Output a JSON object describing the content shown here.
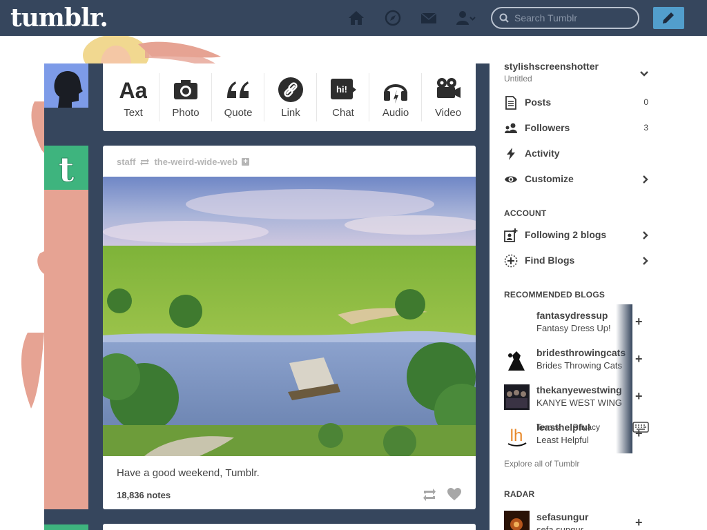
{
  "header": {
    "logo": "tumblr.",
    "search_placeholder": "Search Tumblr",
    "nav_icons": [
      "home-icon",
      "explore-icon",
      "inbox-icon",
      "account-icon",
      "compose-icon"
    ]
  },
  "post_types": [
    {
      "label": "Text",
      "icon": "text-icon"
    },
    {
      "label": "Photo",
      "icon": "camera-icon"
    },
    {
      "label": "Quote",
      "icon": "quote-icon"
    },
    {
      "label": "Link",
      "icon": "link-icon"
    },
    {
      "label": "Chat",
      "icon": "chat-icon",
      "bubble": "hi!"
    },
    {
      "label": "Audio",
      "icon": "headphones-icon"
    },
    {
      "label": "Video",
      "icon": "video-camera-icon"
    }
  ],
  "post": {
    "author": "staff",
    "reblogged_from": "the-weird-wide-web",
    "caption": "Have a good weekend, Tumblr.",
    "notes": "18,836 notes"
  },
  "sidebar": {
    "blog_name": "stylishscreenshotter",
    "blog_title": "Untitled",
    "items": [
      {
        "label": "Posts",
        "count": "0",
        "icon": "posts-icon"
      },
      {
        "label": "Followers",
        "count": "3",
        "icon": "followers-icon"
      },
      {
        "label": "Activity",
        "icon": "activity-icon"
      },
      {
        "label": "Customize",
        "icon": "eye-icon"
      }
    ],
    "account_heading": "ACCOUNT",
    "account_items": [
      {
        "label": "Following 2 blogs",
        "icon": "following-icon"
      },
      {
        "label": "Find Blogs",
        "icon": "find-blogs-icon"
      }
    ],
    "recommended_heading": "RECOMMENDED BLOGS",
    "recommended": [
      {
        "name": "fantasydressup",
        "title": "Fantasy Dress Up!"
      },
      {
        "name": "bridesthrowingcats",
        "title": "Brides Throwing Cats"
      },
      {
        "name": "thekanyewestwing",
        "title": "KANYE WEST WING"
      },
      {
        "name": "leasthelpful",
        "title": "Least Helpful"
      }
    ],
    "footer_links": [
      "Terms",
      "Privacy"
    ],
    "explore_link": "Explore all of Tumblr",
    "radar_heading": "RADAR",
    "radar": {
      "name": "sefasungur",
      "title": "sefa sungur"
    }
  },
  "colors": {
    "header_bg": "#36465d",
    "compose_blue": "#529ecc",
    "staff_green": "#3eb47e",
    "accent_peach": "#e6a393"
  }
}
